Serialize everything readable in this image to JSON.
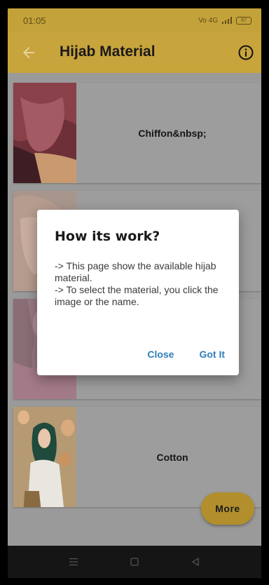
{
  "status_bar": {
    "time": "01:05",
    "signal_text": "Vo 4G",
    "battery": "67"
  },
  "app_bar": {
    "title": "Hijab Material"
  },
  "materials": [
    {
      "name": "Chiffon&nbsp;"
    },
    {
      "name": ""
    },
    {
      "name": ""
    },
    {
      "name": "Cotton"
    }
  ],
  "fab": {
    "label": "More"
  },
  "dialog": {
    "title": "How its work?",
    "line1": "-> This page show the available hijab material.",
    "line2": "-> To select the material, you click the image or the name.",
    "close_label": "Close",
    "ok_label": "Got It"
  },
  "colors": {
    "accent": "#c8a43c",
    "dialog_button": "#2f7fb8"
  }
}
